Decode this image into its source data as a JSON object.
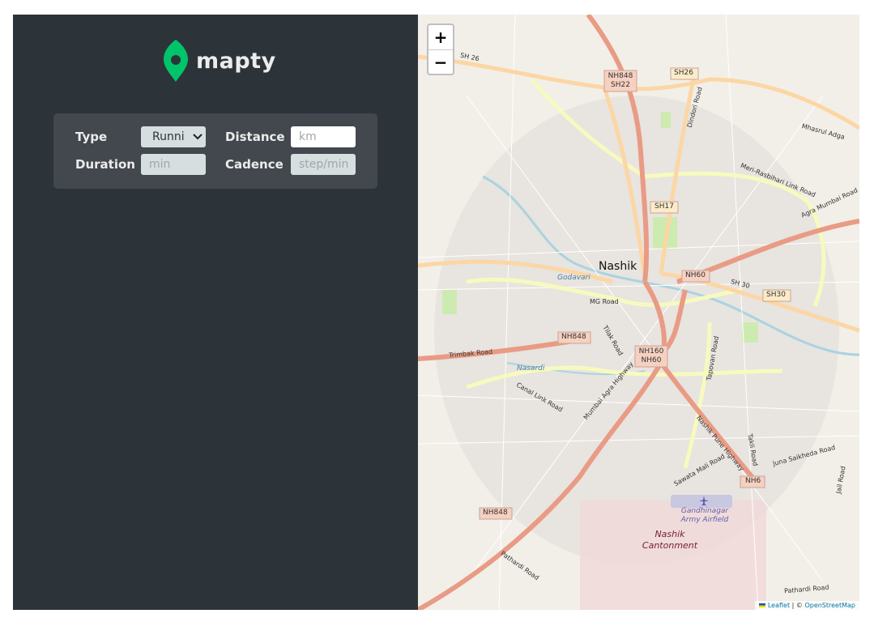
{
  "brand": {
    "name": "mapty",
    "logo_color": "#00c46a"
  },
  "form": {
    "type_label": "Type",
    "type_value": "Runni",
    "distance_label": "Distance",
    "distance_placeholder": "km",
    "duration_label": "Duration",
    "duration_placeholder": "min",
    "cadence_label": "Cadence",
    "cadence_placeholder": "step/min"
  },
  "map": {
    "zoom_in": "+",
    "zoom_out": "−",
    "city": "Nashik",
    "labels": {
      "nh848_sh22": "NH848 SH22",
      "sh26_road": "SH 26",
      "sh26": "SH26",
      "dindori_road": "Dindori Road",
      "mhasrul": "Mhasrul Adga",
      "meri_rasbihari": "Meri-Rasbihari Link Road",
      "agra_mumbai_road": "Agra Mumbai Road",
      "sh17": "SH17",
      "godavari": "Godavari",
      "nh60": "NH60",
      "sh30_road": "SH 30",
      "sh30": "SH30",
      "mg_road": "MG Road",
      "nh848": "NH848",
      "tilak_road": "Tilak Road",
      "trimbak_road": "Trimbak Road",
      "nh160_nh60": "NH160 NH60",
      "nasardi": "Nasardi",
      "canal_link": "Canal Link Road",
      "mumbai_agra": "Mumbai Agra Highway",
      "tapovan": "Tapovan Road",
      "nashik_pune": "Nashik Pune Highway",
      "takli": "Takli Road",
      "juna_saikheda": "Juna Saikheda Road",
      "nh6": "NH6",
      "sawata_mali": "Sawata Mali Road",
      "airfield": "Gandhinagar Army Airfield",
      "cantonment": "Nashik Cantonment",
      "pathardi": "Pathardi Road",
      "pathardi_road2": "Pathardi Road",
      "jail_road": "Jail Road"
    },
    "attribution_leaflet": "Leaflet",
    "attribution_sep": " | © ",
    "attribution_osm": "OpenStreetMap"
  }
}
